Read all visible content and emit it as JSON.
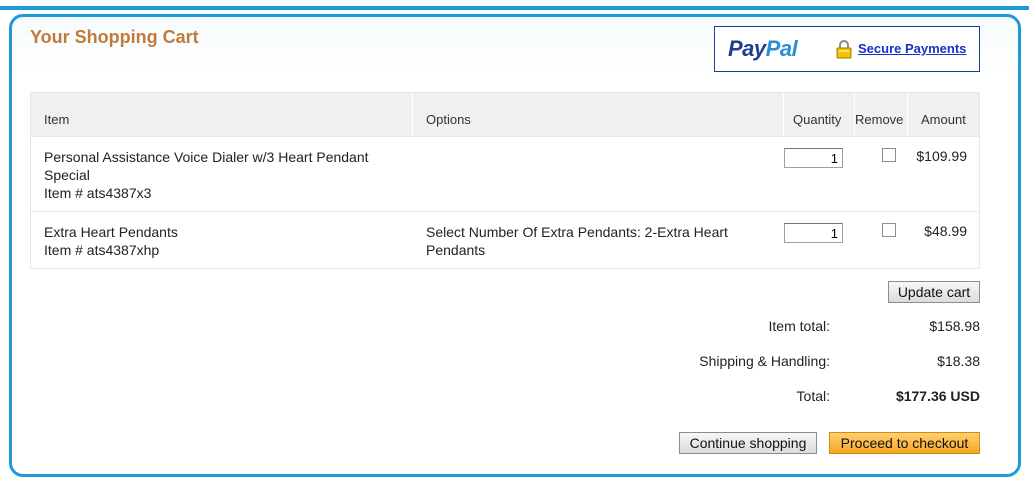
{
  "header": {
    "title": "Your Shopping Cart",
    "paypal_pay": "Pay",
    "paypal_pal": "Pal",
    "secure_link": "Secure Payments"
  },
  "table": {
    "columns": {
      "item": "Item",
      "options": "Options",
      "quantity": "Quantity",
      "remove": "Remove",
      "amount": "Amount"
    },
    "rows": [
      {
        "name_line1": "Personal Assistance Voice Dialer w/3 Heart Pendant",
        "name_line2": "Special",
        "item_no": "Item # ats4387x3",
        "options_line1": "",
        "options_line2": "",
        "quantity": "1",
        "remove_checked": false,
        "amount": "$109.99"
      },
      {
        "name_line1": "Extra Heart Pendants",
        "name_line2": "",
        "item_no": "Item # ats4387xhp",
        "options_line1": "Select Number Of Extra Pendants: 2-Extra Heart",
        "options_line2": "Pendants",
        "quantity": "1",
        "remove_checked": false,
        "amount": "$48.99"
      }
    ]
  },
  "buttons": {
    "update_cart": "Update cart",
    "continue_shopping": "Continue shopping",
    "checkout": "Proceed to checkout"
  },
  "summary": {
    "item_total_label": "Item total:",
    "item_total_value": "$158.98",
    "shipping_label": "Shipping & Handling:",
    "shipping_value": "$18.38",
    "total_label": "Total:",
    "total_value": "$177.36 USD"
  },
  "colors": {
    "frame_border": "#1e9ad6",
    "title": "#c17a3a",
    "checkout_button": "#f6a623",
    "paypal_dark": "#1d3f8f",
    "paypal_light": "#2c8fd3"
  }
}
